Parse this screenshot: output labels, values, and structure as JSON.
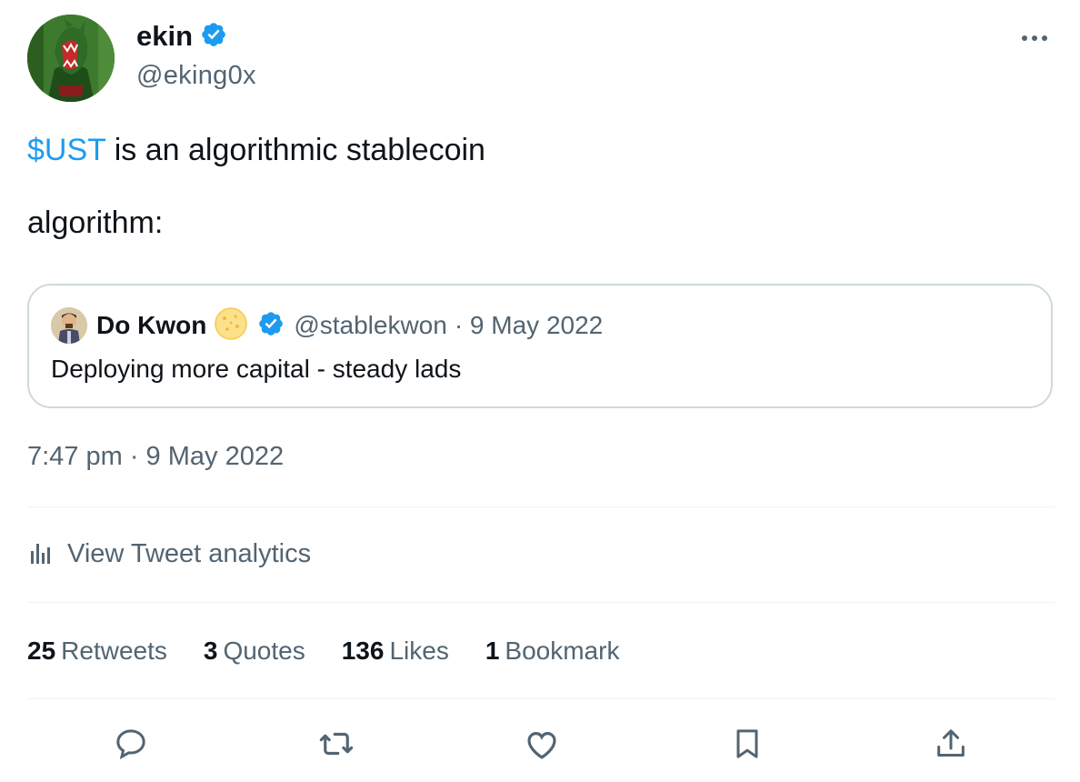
{
  "tweet": {
    "author": {
      "name": "ekin",
      "handle": "@eking0x",
      "verified": true,
      "avatar_icon": "green-dragon-avatar"
    },
    "text_cashtag": "$UST",
    "text_line1_rest": " is an algorithmic stablecoin",
    "text_line2": "algorithm:",
    "timestamp": "7:47 pm · 9 May 2022"
  },
  "quoted_tweet": {
    "name": "Do Kwon",
    "emoji_icon": "cookie-icon",
    "handle": "@stablekwon",
    "date": "· 9 May 2022",
    "text": "Deploying more capital - steady lads"
  },
  "analytics": {
    "label": "View Tweet analytics",
    "icon": "bar-chart-icon"
  },
  "stats": {
    "retweets_count": "25",
    "retweets_label": "Retweets",
    "quotes_count": "3",
    "quotes_label": "Quotes",
    "likes_count": "136",
    "likes_label": "Likes",
    "bookmarks_count": "1",
    "bookmarks_label": "Bookmark"
  },
  "actions": [
    "reply-icon",
    "retweet-icon",
    "like-icon",
    "bookmark-icon",
    "share-icon"
  ],
  "colors": {
    "accent": "#1d9bf0",
    "text": "#0f1419",
    "muted": "#536471",
    "border": "#cfd9de"
  }
}
